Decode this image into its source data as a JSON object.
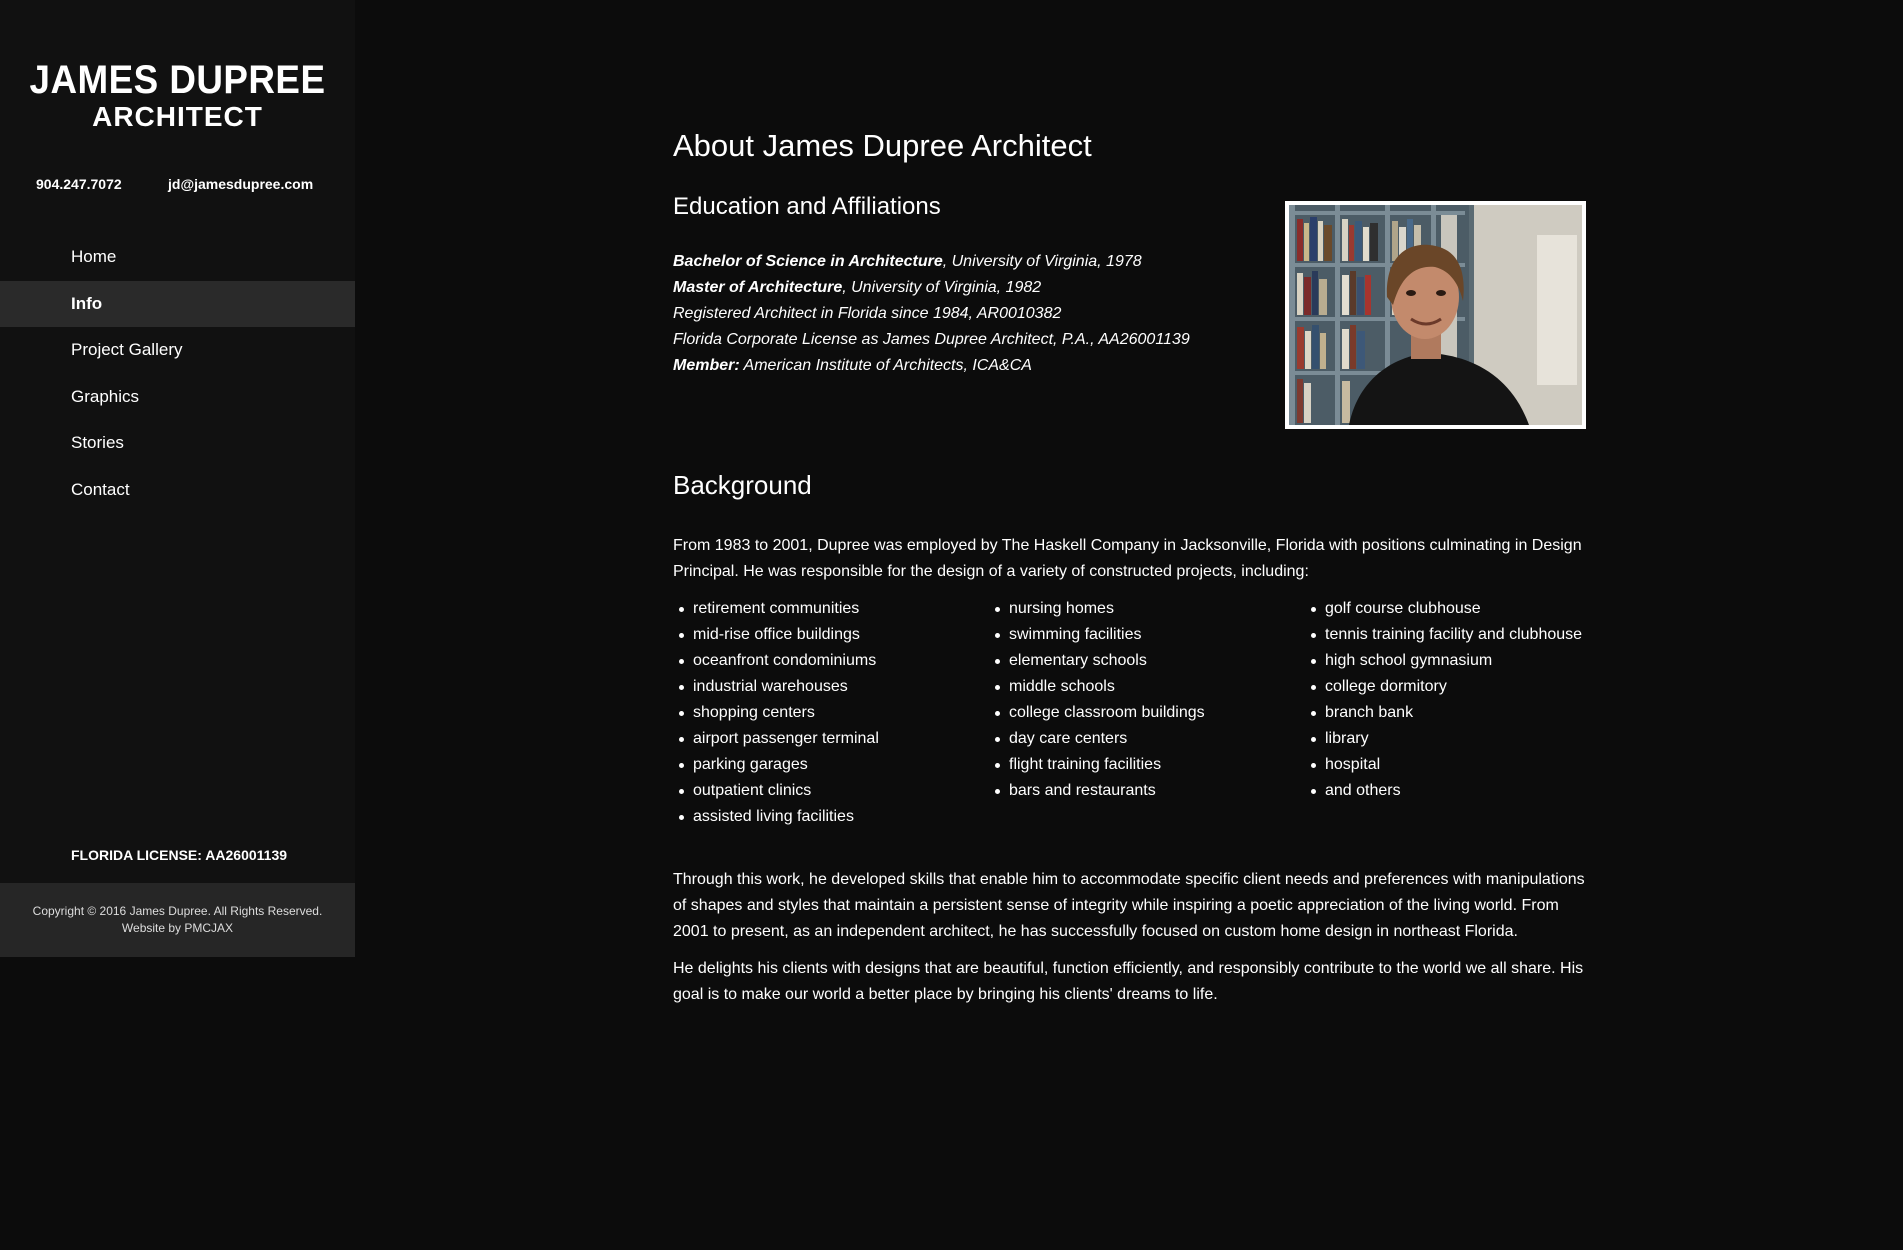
{
  "sidebar": {
    "logo_name": "JAMES DUPREE",
    "logo_sub": "ARCHITECT",
    "phone": "904.247.7072",
    "email": "jd@jamesdupree.com",
    "nav": [
      "Home",
      "Info",
      "Project Gallery",
      "Graphics",
      "Stories",
      "Contact"
    ],
    "active_nav": "Info",
    "license": "FLORIDA LICENSE: AA26001139",
    "copyright": "Copyright © 2016 James Dupree. All Rights Reserved.",
    "website_by_prefix": "Website by ",
    "website_by_link": "PMCJAX"
  },
  "main": {
    "title": "About James Dupree Architect",
    "education_heading": "Education and Affiliations",
    "education": [
      {
        "bold": "Bachelor of Science in Architecture",
        "rest": ", University of Virginia, 1978"
      },
      {
        "bold": "Master of Architecture",
        "rest": ", University of Virginia, 1982"
      },
      {
        "bold": "",
        "rest": "Registered Architect in Florida since 1984, AR0010382"
      },
      {
        "bold": "",
        "rest": "Florida Corporate License as James Dupree Architect, P.A., AA26001139"
      },
      {
        "bold": "Member:",
        "rest": " American Institute of Architects, ICA&CA"
      }
    ],
    "background_heading": "Background",
    "paragraph1": "From 1983 to 2001, Dupree was employed by The Haskell Company in Jacksonville, Florida with positions culminating in Design Principal. He was responsible for the design of a variety of constructed projects, including:",
    "projects_col1": [
      "retirement communities",
      "mid-rise office buildings",
      "oceanfront condominiums",
      "industrial warehouses",
      "shopping centers",
      "airport passenger terminal",
      "parking garages",
      "outpatient clinics",
      "assisted living facilities"
    ],
    "projects_col2": [
      "nursing homes",
      "swimming facilities",
      "elementary schools",
      "middle schools",
      "college classroom buildings",
      "day care centers",
      "flight training facilities",
      "bars and restaurants"
    ],
    "projects_col3": [
      "golf course clubhouse",
      "tennis training facility and clubhouse",
      "high school gymnasium",
      "college dormitory",
      "branch bank",
      "library",
      "hospital",
      "and others"
    ],
    "paragraph2": "Through this work, he developed skills that enable him to accommodate specific client needs and preferences with manipulations of shapes and styles that maintain a persistent sense of integrity while inspiring a poetic appreciation of the living world. From 2001 to present, as an independent architect, he has successfully focused on custom home design in northeast Florida.",
    "paragraph3": "He delights his clients with designs that are beautiful, function efficiently, and responsibly contribute to the world we all share. His goal is to make our world a better place by bringing his clients' dreams to life."
  },
  "colors": {
    "background": "#0c0c0c",
    "sidebar": "#111111",
    "nav_active": "#2a2a2a",
    "footer": "#262626",
    "text": "#ffffff"
  }
}
